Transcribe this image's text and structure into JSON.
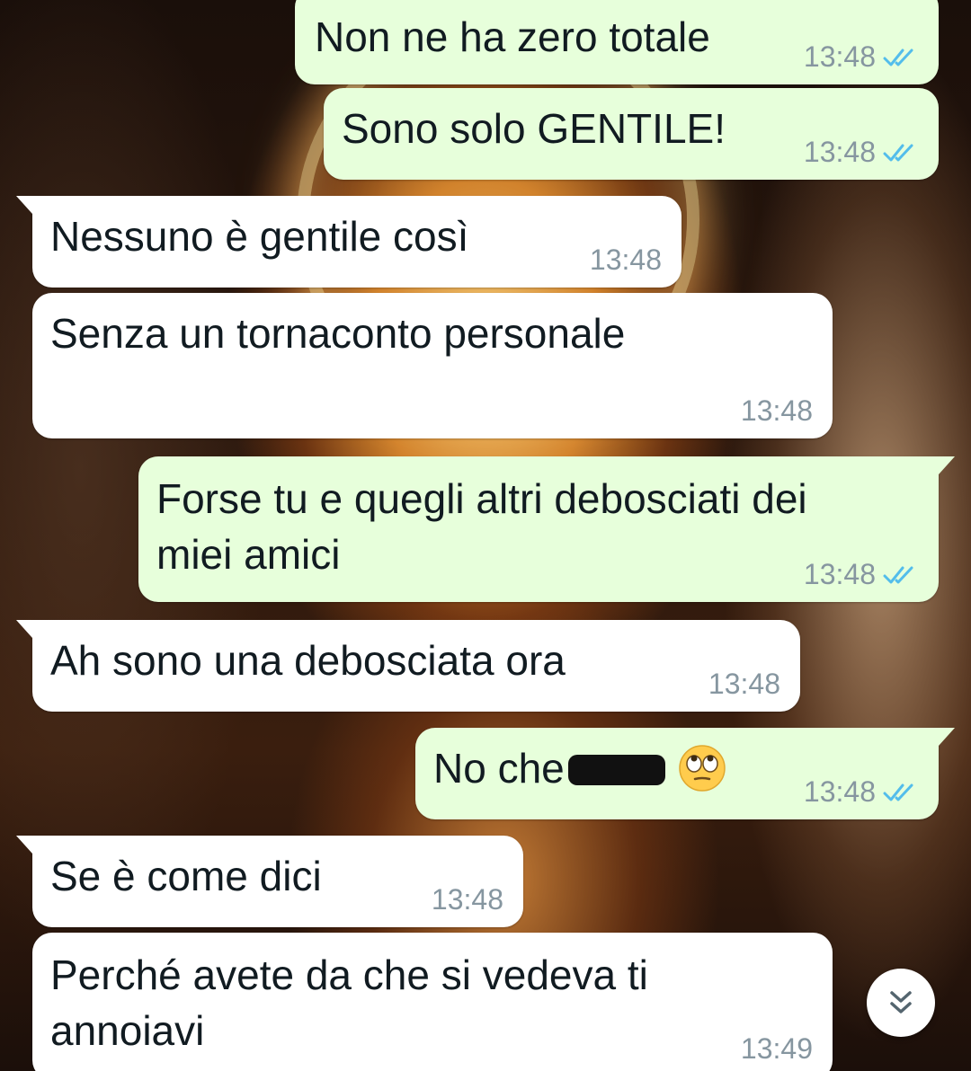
{
  "messages": [
    {
      "id": "m1",
      "direction": "outgoing",
      "text": "Non ne ha zero totale",
      "time": "13:48",
      "status": "read"
    },
    {
      "id": "m2",
      "direction": "outgoing",
      "text": "Sono solo GENTILE!",
      "time": "13:48",
      "status": "read"
    },
    {
      "id": "m3",
      "direction": "incoming",
      "text": "Nessuno è gentile così",
      "time": "13:48"
    },
    {
      "id": "m4",
      "direction": "incoming",
      "text": "Senza un tornaconto personale",
      "time": "13:48"
    },
    {
      "id": "m5",
      "direction": "outgoing",
      "line1": "Forse tu e quegli altri debosciati dei",
      "line2": "miei amici",
      "time": "13:48",
      "status": "read"
    },
    {
      "id": "m6",
      "direction": "incoming",
      "text": "Ah sono una debosciata ora",
      "time": "13:48"
    },
    {
      "id": "m7",
      "direction": "outgoing",
      "text": "No che",
      "redacted": true,
      "emoji": "face-with-rolling-eyes",
      "time": "13:48",
      "status": "read"
    },
    {
      "id": "m8",
      "direction": "incoming",
      "text": "Se è come dici",
      "time": "13:48"
    },
    {
      "id": "m9",
      "direction": "incoming",
      "line1": "Perché avete da che si vedeva ti",
      "line2": "annoiavi",
      "time": "13:49"
    }
  ],
  "colors": {
    "outgoing_bubble": "#e7ffdb",
    "incoming_bubble": "#ffffff",
    "text": "#111b21",
    "timestamp": "#8696a0",
    "read_ticks": "#53bdeb"
  },
  "icons": {
    "read_receipt": "double-check-icon",
    "scroll_down": "double-chevron-down-icon"
  }
}
